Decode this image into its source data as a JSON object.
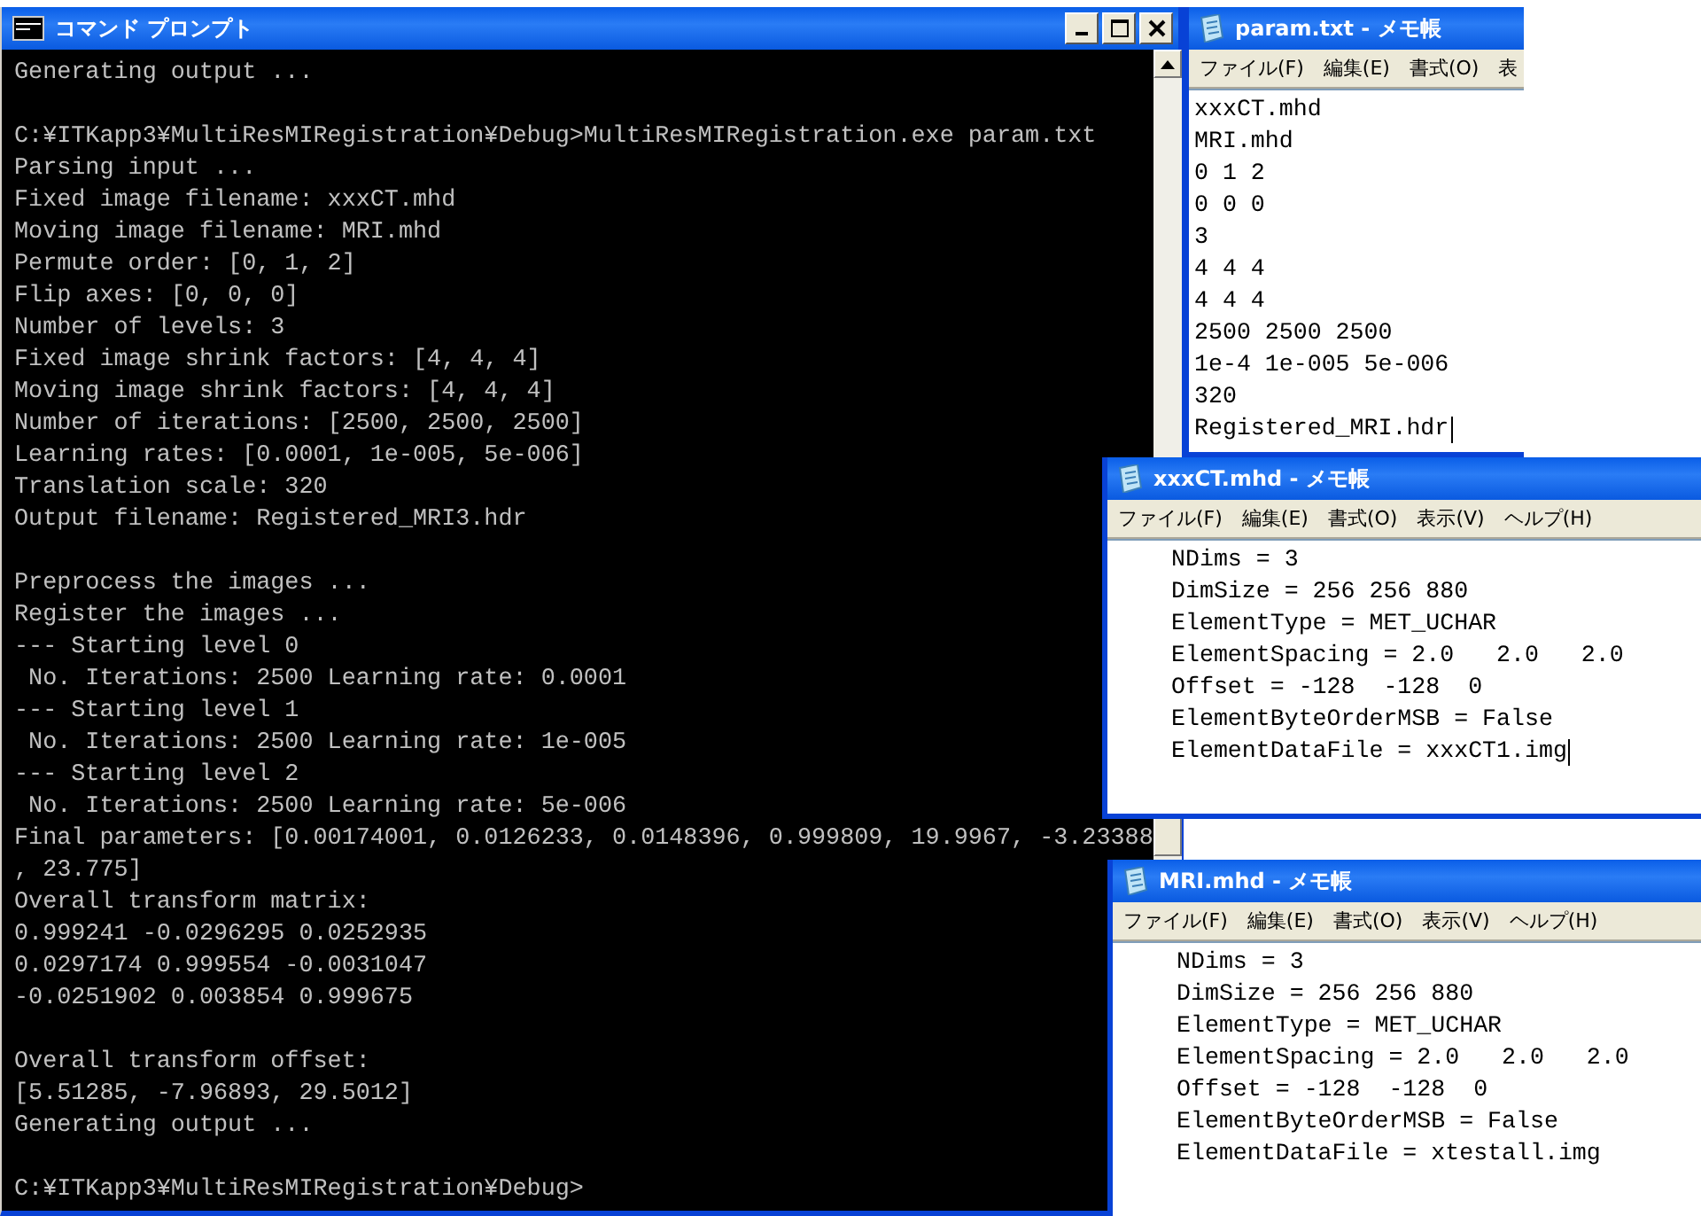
{
  "console": {
    "title": "コマンド プロンプト",
    "blocks": [
      [
        "Generating output ..."
      ],
      [
        "C:¥ITKapp3¥MultiResMIRegistration¥Debug>MultiResMIRegistration.exe param.txt",
        "Parsing input ...",
        "Fixed image filename: xxxCT.mhd",
        "Moving image filename: MRI.mhd",
        "Permute order: [0, 1, 2]",
        "Flip axes: [0, 0, 0]",
        "Number of levels: 3",
        "Fixed image shrink factors: [4, 4, 4]",
        "Moving image shrink factors: [4, 4, 4]",
        "Number of iterations: [2500, 2500, 2500]",
        "Learning rates: [0.0001, 1e-005, 5e-006]",
        "Translation scale: 320",
        "Output filename: Registered_MRI3.hdr"
      ],
      [
        "Preprocess the images ...",
        "Register the images ...",
        "--- Starting level 0",
        " No. Iterations: 2500 Learning rate: 0.0001",
        "--- Starting level 1",
        " No. Iterations: 2500 Learning rate: 1e-005",
        "--- Starting level 2",
        " No. Iterations: 2500 Learning rate: 5e-006",
        "Final parameters: [0.00174001, 0.0126233, 0.0148396, 0.999809, 19.9967, -3.23388",
        ", 23.775]",
        "Overall transform matrix:",
        "0.999241 -0.0296295 0.0252935",
        "0.0297174 0.999554 -0.0031047",
        "-0.0251902 0.003854 0.999675"
      ],
      [
        "Overall transform offset:",
        "[5.51285, -7.96893, 29.5012]",
        "Generating output ..."
      ],
      [
        "C:¥ITKapp3¥MultiResMIRegistration¥Debug>"
      ]
    ]
  },
  "notepads": [
    {
      "title": "param.txt - メモ帳",
      "menu": [
        "ファイル(F)",
        "編集(E)",
        "書式(O)",
        "表"
      ],
      "lines": [
        "xxxCT.mhd",
        "MRI.mhd",
        "0 1 2",
        "0 0 0",
        "3",
        "4 4 4",
        "4 4 4",
        "2500 2500 2500",
        "1e-4 1e-005 5e-006",
        "320",
        "Registered_MRI.hdr"
      ],
      "caret": true
    },
    {
      "title": "xxxCT.mhd - メモ帳",
      "menu": [
        "ファイル(F)",
        "編集(E)",
        "書式(O)",
        "表示(V)",
        "ヘルプ(H)"
      ],
      "lines": [
        "NDims = 3",
        "DimSize = 256 256 880",
        "ElementType = MET_UCHAR",
        "ElementSpacing = 2.0   2.0   2.0",
        "Offset = -128  -128  0",
        "ElementByteOrderMSB = False",
        "ElementDataFile = xxxCT1.img"
      ],
      "caret": true
    },
    {
      "title": "MRI.mhd - メモ帳",
      "menu": [
        "ファイル(F)",
        "編集(E)",
        "書式(O)",
        "表示(V)",
        "ヘルプ(H)"
      ],
      "lines": [
        "NDims = 3",
        "DimSize = 256 256 880",
        "ElementType = MET_UCHAR",
        "ElementSpacing = 2.0   2.0   2.0",
        "Offset = -128  -128  0",
        "ElementByteOrderMSB = False",
        "ElementDataFile = xtestall.img"
      ],
      "caret": false
    }
  ]
}
